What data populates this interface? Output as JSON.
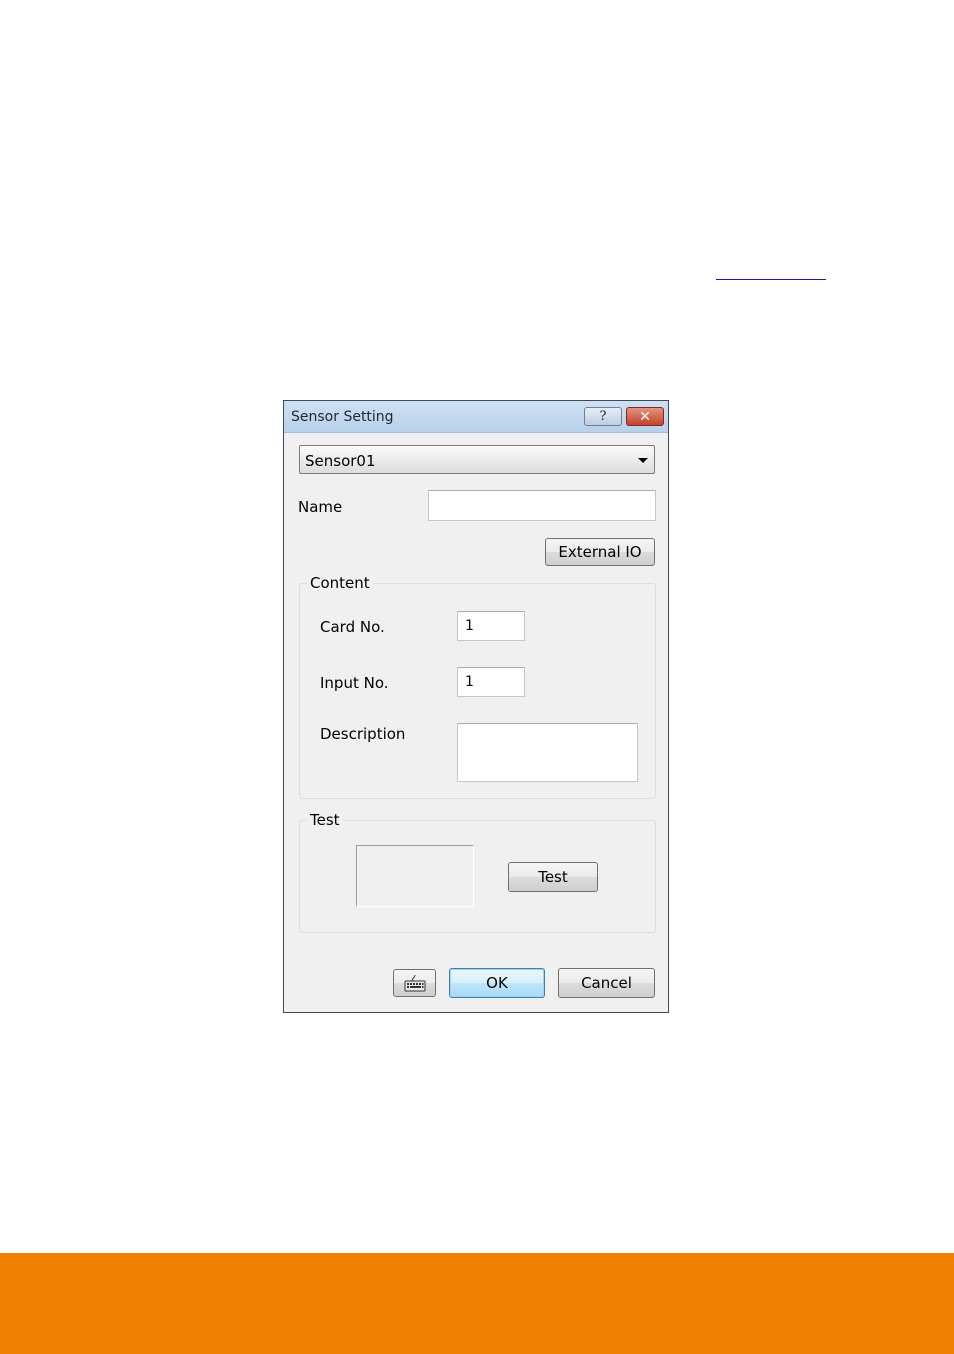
{
  "dialog": {
    "title": "Sensor Setting",
    "help_symbol": "?",
    "close_symbol": "✕",
    "sensor_select": {
      "selected": "Sensor01"
    },
    "name": {
      "label": "Name",
      "value": ""
    },
    "external_io_label": "External IO",
    "content": {
      "title": "Content",
      "card_no": {
        "label": "Card No.",
        "value": "1"
      },
      "input_no": {
        "label": "Input No.",
        "value": "1"
      },
      "description": {
        "label": "Description",
        "value": ""
      }
    },
    "test": {
      "title": "Test",
      "button_label": "Test"
    },
    "buttons": {
      "keyboard_icon": "keyboard-icon",
      "ok": "OK",
      "cancel": "Cancel"
    }
  },
  "colors": {
    "footer_band": "#ef8200",
    "titlebar": "#c4d8ee",
    "dialog_bg": "#f0f0f0",
    "close_button": "#c2432b"
  }
}
